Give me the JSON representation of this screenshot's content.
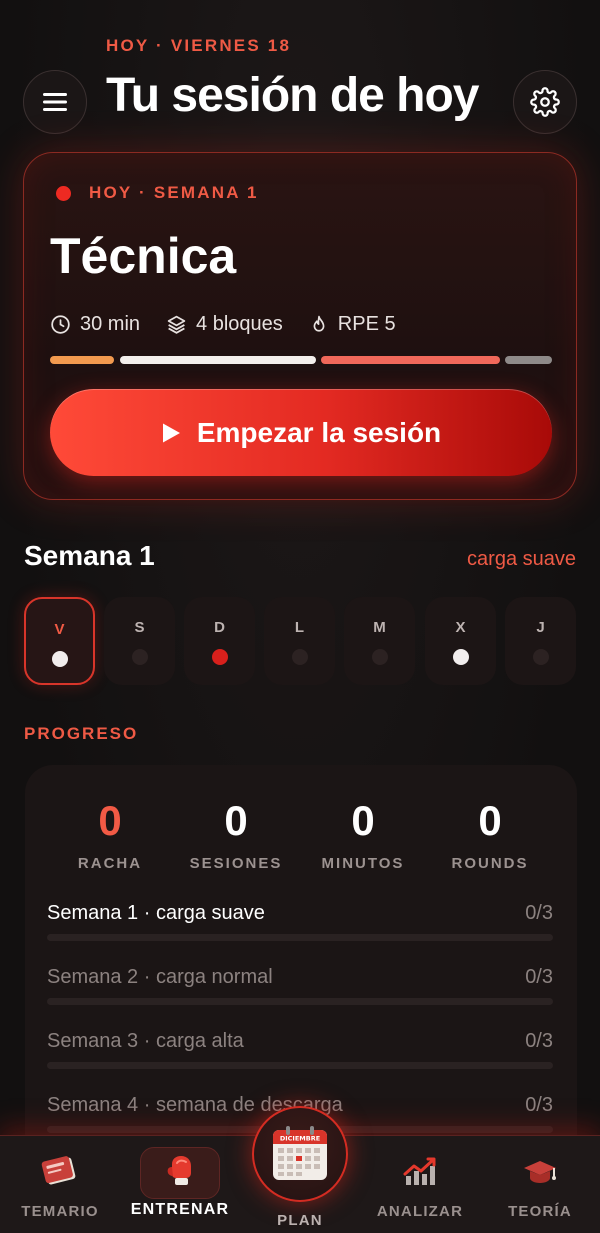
{
  "header": {
    "date_label": "HOY · VIERNES 18",
    "title": "Tu sesión de hoy",
    "menu_icon": "menu-icon",
    "settings_icon": "gear-icon"
  },
  "session": {
    "badge": "HOY · SEMANA 1",
    "title": "Técnica",
    "duration": "30 min",
    "blocks": "4 bloques",
    "rpe": "RPE 5",
    "block_bar_colors": [
      "#f29a4f",
      "#f3efec",
      "#f0685a",
      "#8e8a89"
    ],
    "start_label": "Empezar la sesión"
  },
  "week": {
    "title": "Semana 1",
    "load": "carga suave",
    "days": [
      {
        "letter": "V",
        "status": "done",
        "active": true
      },
      {
        "letter": "S",
        "status": "empty"
      },
      {
        "letter": "D",
        "status": "planned"
      },
      {
        "letter": "L",
        "status": "empty"
      },
      {
        "letter": "M",
        "status": "empty"
      },
      {
        "letter": "X",
        "status": "done"
      },
      {
        "letter": "J",
        "status": "empty"
      }
    ]
  },
  "progress": {
    "section_label": "PROGRESO",
    "stats": [
      {
        "value": "0",
        "label": "RACHA"
      },
      {
        "value": "0",
        "label": "SESIONES"
      },
      {
        "value": "0",
        "label": "MINUTOS"
      },
      {
        "value": "0",
        "label": "ROUNDS"
      }
    ],
    "weeks": [
      {
        "label": "Semana 1 · carga suave",
        "count": "0/3",
        "progress": 0
      },
      {
        "label": "Semana 2 · carga normal",
        "count": "0/3",
        "progress": 0
      },
      {
        "label": "Semana 3 · carga alta",
        "count": "0/3",
        "progress": 0
      },
      {
        "label": "Semana 4 · semana de descarga",
        "count": "0/3",
        "progress": 0
      }
    ]
  },
  "tabbar": {
    "items": [
      {
        "label": "TEMARIO",
        "icon": "book-icon"
      },
      {
        "label": "ENTRENAR",
        "icon": "boxing-glove-icon"
      },
      {
        "label": "PLAN",
        "icon": "calendar-icon"
      },
      {
        "label": "ANALIZAR",
        "icon": "chart-icon"
      },
      {
        "label": "TEORÍA",
        "icon": "graduation-cap-icon"
      }
    ],
    "calendar_month": "DICIEMBRE"
  },
  "colors": {
    "accent": "#ef5a45",
    "primary_red": "#e32a22",
    "background": "#151212"
  }
}
